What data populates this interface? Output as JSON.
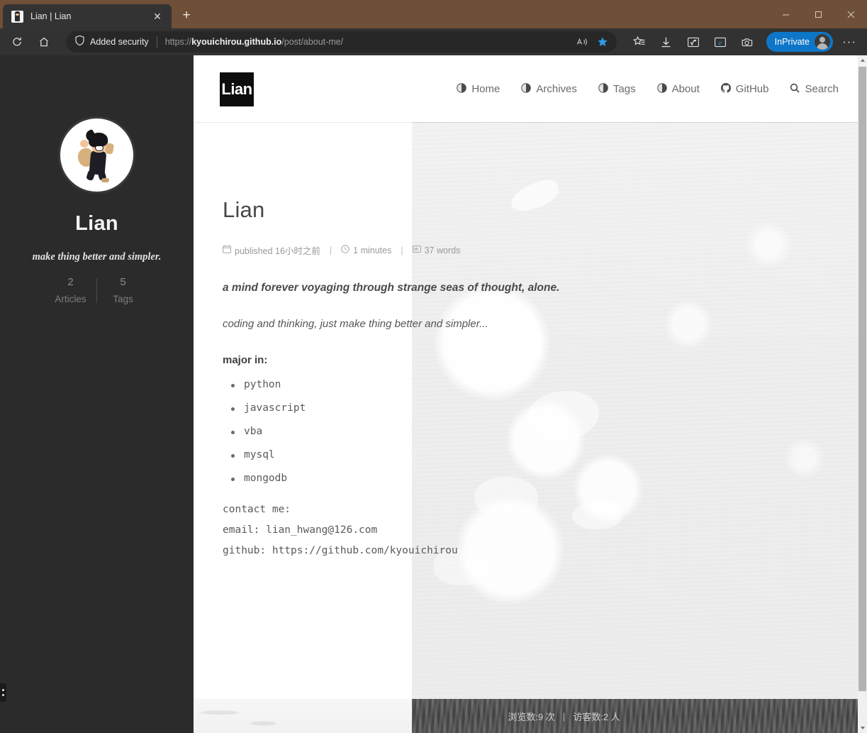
{
  "browser": {
    "tab": {
      "title": "Lian | Lian",
      "favicon": "avatar-favicon",
      "close_label": "✕"
    },
    "new_tab_label": "+",
    "window_controls": {
      "minimize": "minimize-icon",
      "maximize": "maximize-icon",
      "close": "close-icon"
    },
    "toolbar": {
      "refresh_label": "refresh-icon",
      "home_label": "home-icon",
      "security_label": "Added security",
      "url_prefix": "https://",
      "url_domain": "kyouichirou.github.io",
      "url_path": "/post/about-me/",
      "read_aloud_label": "read-aloud-icon",
      "favorite_label": "favorite-star-icon",
      "collections_label": "collections-icon",
      "downloads_label": "downloads-icon",
      "math_solver_label": "math-solver-icon",
      "ie_mode_label": "internet-explorer-icon",
      "screenshot_label": "web-capture-icon",
      "profile_label": "InPrivate",
      "settings_label": "···"
    },
    "accent_color": "#0d76c8",
    "titlebar_color": "#6f4f37"
  },
  "site": {
    "logo_text": "Lian",
    "nav": [
      {
        "label": "Home",
        "icon": "globe-icon"
      },
      {
        "label": "Archives",
        "icon": "globe-icon"
      },
      {
        "label": "Tags",
        "icon": "globe-icon"
      },
      {
        "label": "About",
        "icon": "globe-icon"
      },
      {
        "label": "GitHub",
        "icon": "github-icon"
      },
      {
        "label": "Search",
        "icon": "search-icon"
      }
    ],
    "sidebar": {
      "avatar_alt": "avatar-image",
      "name": "Lian",
      "tagline": "make thing better and simpler.",
      "stats": [
        {
          "count": "2",
          "label": "Articles"
        },
        {
          "count": "5",
          "label": "Tags"
        }
      ]
    },
    "post": {
      "title": "Lian",
      "meta": {
        "published": "published 16小时之前",
        "read_time": "1 minutes",
        "word_count": "37 words",
        "separator": "|"
      },
      "lead": "a mind forever voyaging through strange seas of thought, alone.",
      "paragraph": "coding and thinking, just make thing better and simpler...",
      "major_heading": "major in:",
      "major_list": [
        "python",
        "javascript",
        "vba",
        "mysql",
        "mongodb"
      ],
      "contact": [
        "contact me:",
        "email: lian_hwang@126.com",
        "github: https://github.com/kyouichirou"
      ]
    },
    "footer": {
      "views": "浏览数:9 次",
      "separator": "|",
      "visitors": "访客数:2 人"
    }
  }
}
